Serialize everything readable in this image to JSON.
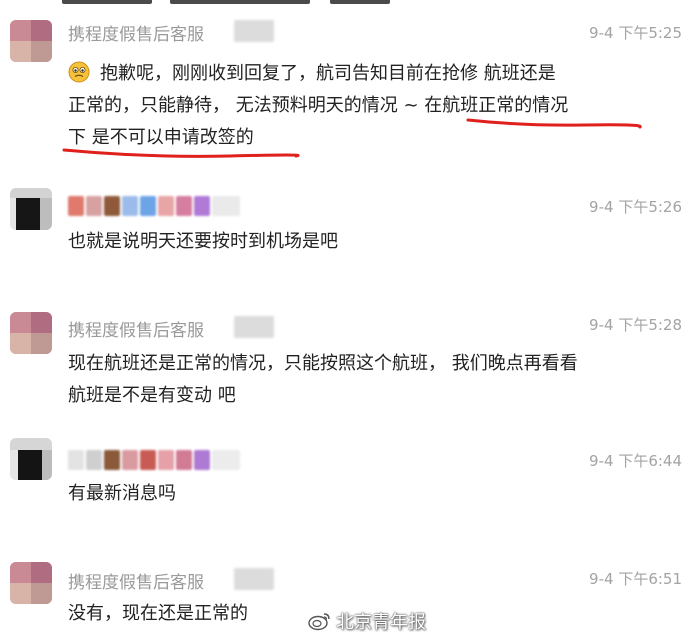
{
  "messages": [
    {
      "sender": "携程度假售后客服",
      "time": "9-4 下午5:25",
      "line1": "抱歉呢，刚刚收到回复了，航司告知目前在抢修 航班还是",
      "line2_a": "正常的，只能静待， 无法预料明天的情况 ~ ",
      "line2_b": "在航班正常的情况",
      "line3": "下 是不可以申请改签的",
      "emoji": "worried-face-emoji",
      "annotation_color": "#e0201c"
    },
    {
      "sender": "",
      "time": "9-4 下午5:26",
      "text": "也就是说明天还要按时到机场是吧"
    },
    {
      "sender": "携程度假售后客服",
      "time": "9-4 下午5:28",
      "line1": "现在航班还是正常的情况，只能按照这个航班， 我们晚点再看看",
      "line2": "航班是不是有变动 吧"
    },
    {
      "sender": "",
      "time": "9-4 下午6:44",
      "text": "有最新消息吗"
    },
    {
      "sender": "携程度假售后客服",
      "time": "9-4 下午6:51",
      "text": "没有，现在还是正常的"
    }
  ],
  "watermark": {
    "text": "北京青年报",
    "icon": "weibo-icon"
  },
  "colors": {
    "name": "#9a9a9a",
    "time": "#a3a3a3",
    "text": "#222222",
    "red_annotation": "#e0201c"
  }
}
